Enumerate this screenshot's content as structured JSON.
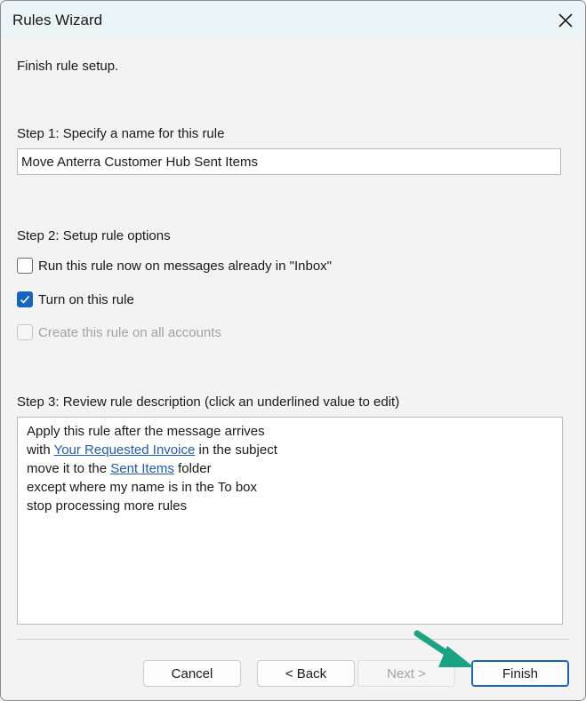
{
  "window": {
    "title": "Rules Wizard"
  },
  "intro": "Finish rule setup.",
  "step1": {
    "label": "Step 1: Specify a name for this rule",
    "name_value": "Move Anterra Customer Hub Sent Items"
  },
  "step2": {
    "label": "Step 2: Setup rule options",
    "options": [
      {
        "label": "Run this rule now on messages already in \"Inbox\"",
        "checked": false,
        "enabled": true
      },
      {
        "label": "Turn on this rule",
        "checked": true,
        "enabled": true
      },
      {
        "label": "Create this rule on all accounts",
        "checked": false,
        "enabled": false
      }
    ]
  },
  "step3": {
    "label": "Step 3: Review rule description (click an underlined value to edit)",
    "line1": "Apply this rule after the message arrives",
    "line2_pre": "with ",
    "line2_link": "Your Requested Invoice",
    "line2_post": " in the subject",
    "line3_pre": "move it to the ",
    "line3_link": "Sent Items",
    "line3_post": " folder",
    "line4": "except where my name is in the To box",
    "line5": "stop processing more rules"
  },
  "buttons": {
    "cancel": "Cancel",
    "back": "< Back",
    "next": "Next >",
    "finish": "Finish"
  },
  "colors": {
    "accent": "#1565c0",
    "link": "#1f5bb5",
    "arrow": "#1aa383",
    "titlebar": "#eaf4f6"
  },
  "icons": {
    "close": "close-icon",
    "check": "check-icon",
    "pointer": "arrow-pointer-icon"
  }
}
